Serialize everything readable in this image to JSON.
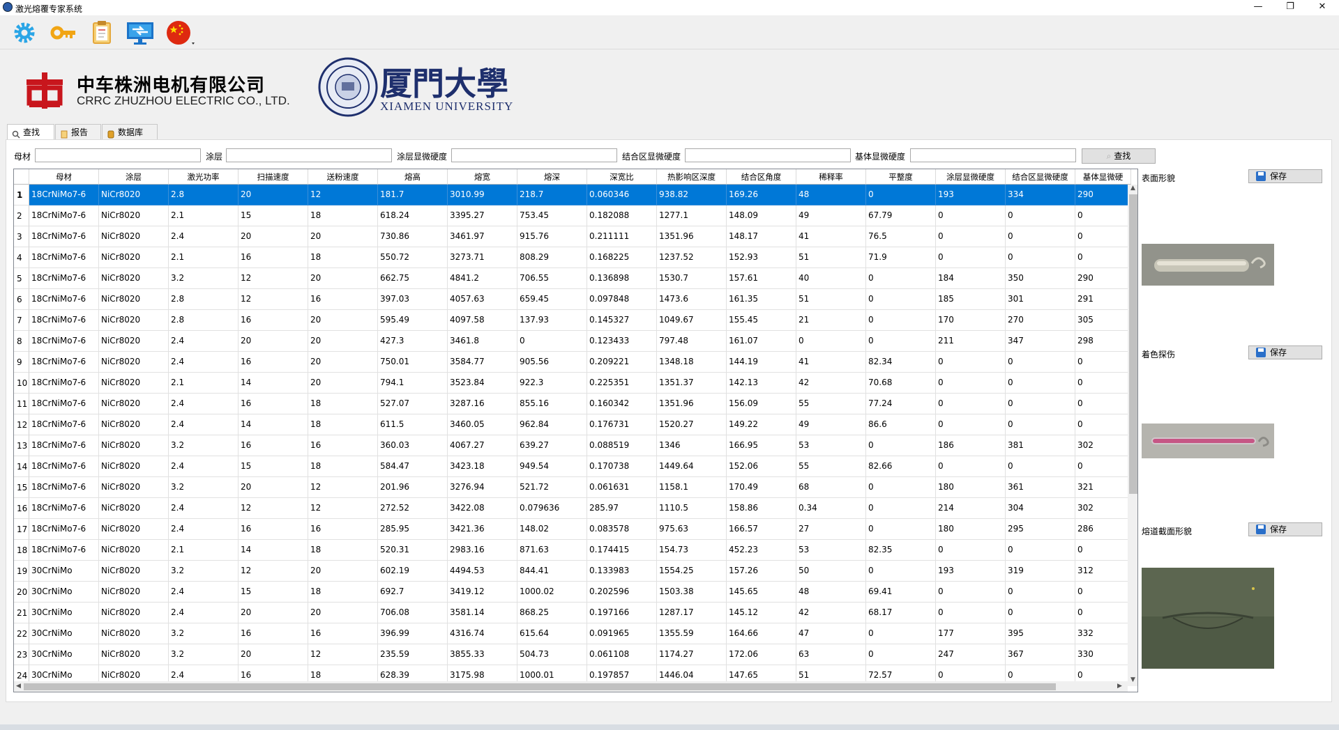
{
  "window": {
    "title": "激光熔覆专家系统",
    "minimize": "—",
    "maximize": "❐",
    "close": "✕"
  },
  "toolbar": {
    "icons": [
      "gear-icon",
      "key-icon",
      "clipboard-icon",
      "network-icon",
      "china-flag-icon"
    ]
  },
  "logos": {
    "crrc_cn": "中车株洲电机有限公司",
    "crrc_en": "CRRC ZHUZHOU ELECTRIC CO., LTD.",
    "xmu_cn": "厦門大學",
    "xmu_en": "XIAMEN UNIVERSITY"
  },
  "tabs": [
    {
      "label": "查找",
      "active": true
    },
    {
      "label": "报告",
      "active": false
    },
    {
      "label": "数据库",
      "active": false
    }
  ],
  "filters": {
    "base_label": "母材",
    "coating_label": "涂层",
    "coating_hv_label": "涂层显微硬度",
    "bond_hv_label": "结合区显微硬度",
    "sub_hv_label": "基体显微硬度",
    "search_label": "查找",
    "base_value": "",
    "coating_value": "",
    "coating_hv_value": "",
    "bond_hv_value": "",
    "sub_hv_value": ""
  },
  "table": {
    "columns": [
      "母材",
      "涂层",
      "激光功率",
      "扫描速度",
      "送粉速度",
      "熔高",
      "熔宽",
      "熔深",
      "深宽比",
      "热影响区深度",
      "结合区角度",
      "稀释率",
      "平整度",
      "涂层显微硬度",
      "结合区显微硬度",
      "基体显微硬"
    ],
    "selected_row": 1,
    "rows": [
      [
        "1",
        "18CrNiMo7-6",
        "NiCr8020",
        "2.8",
        "20",
        "12",
        "181.7",
        "3010.99",
        "218.7",
        "0.060346",
        "938.82",
        "169.26",
        "48",
        "0",
        "193",
        "334",
        "290"
      ],
      [
        "2",
        "18CrNiMo7-6",
        "NiCr8020",
        "2.1",
        "15",
        "18",
        "618.24",
        "3395.27",
        "753.45",
        "0.182088",
        "1277.1",
        "148.09",
        "49",
        "67.79",
        "0",
        "0",
        "0"
      ],
      [
        "3",
        "18CrNiMo7-6",
        "NiCr8020",
        "2.4",
        "20",
        "20",
        "730.86",
        "3461.97",
        "915.76",
        "0.211111",
        "1351.96",
        "148.17",
        "41",
        "76.5",
        "0",
        "0",
        "0"
      ],
      [
        "4",
        "18CrNiMo7-6",
        "NiCr8020",
        "2.1",
        "16",
        "18",
        "550.72",
        "3273.71",
        "808.29",
        "0.168225",
        "1237.52",
        "152.93",
        "51",
        "71.9",
        "0",
        "0",
        "0"
      ],
      [
        "5",
        "18CrNiMo7-6",
        "NiCr8020",
        "3.2",
        "12",
        "20",
        "662.75",
        "4841.2",
        "706.55",
        "0.136898",
        "1530.7",
        "157.61",
        "40",
        "0",
        "184",
        "350",
        "290"
      ],
      [
        "6",
        "18CrNiMo7-6",
        "NiCr8020",
        "2.8",
        "12",
        "16",
        "397.03",
        "4057.63",
        "659.45",
        "0.097848",
        "1473.6",
        "161.35",
        "51",
        "0",
        "185",
        "301",
        "291"
      ],
      [
        "7",
        "18CrNiMo7-6",
        "NiCr8020",
        "2.8",
        "16",
        "20",
        "595.49",
        "4097.58",
        "137.93",
        "0.145327",
        "1049.67",
        "155.45",
        "21",
        "0",
        "170",
        "270",
        "305"
      ],
      [
        "8",
        "18CrNiMo7-6",
        "NiCr8020",
        "2.4",
        "20",
        "20",
        "427.3",
        "3461.8",
        "0",
        "0.123433",
        "797.48",
        "161.07",
        "0",
        "0",
        "211",
        "347",
        "298"
      ],
      [
        "9",
        "18CrNiMo7-6",
        "NiCr8020",
        "2.4",
        "16",
        "20",
        "750.01",
        "3584.77",
        "905.56",
        "0.209221",
        "1348.18",
        "144.19",
        "41",
        "82.34",
        "0",
        "0",
        "0"
      ],
      [
        "10",
        "18CrNiMo7-6",
        "NiCr8020",
        "2.1",
        "14",
        "20",
        "794.1",
        "3523.84",
        "922.3",
        "0.225351",
        "1351.37",
        "142.13",
        "42",
        "70.68",
        "0",
        "0",
        "0"
      ],
      [
        "11",
        "18CrNiMo7-6",
        "NiCr8020",
        "2.4",
        "16",
        "18",
        "527.07",
        "3287.16",
        "855.16",
        "0.160342",
        "1351.96",
        "156.09",
        "55",
        "77.24",
        "0",
        "0",
        "0"
      ],
      [
        "12",
        "18CrNiMo7-6",
        "NiCr8020",
        "2.4",
        "14",
        "18",
        "611.5",
        "3460.05",
        "962.84",
        "0.176731",
        "1520.27",
        "149.22",
        "49",
        "86.6",
        "0",
        "0",
        "0"
      ],
      [
        "13",
        "18CrNiMo7-6",
        "NiCr8020",
        "3.2",
        "16",
        "16",
        "360.03",
        "4067.27",
        "639.27",
        "0.088519",
        "1346",
        "166.95",
        "53",
        "0",
        "186",
        "381",
        "302"
      ],
      [
        "14",
        "18CrNiMo7-6",
        "NiCr8020",
        "2.4",
        "15",
        "18",
        "584.47",
        "3423.18",
        "949.54",
        "0.170738",
        "1449.64",
        "152.06",
        "55",
        "82.66",
        "0",
        "0",
        "0"
      ],
      [
        "15",
        "18CrNiMo7-6",
        "NiCr8020",
        "3.2",
        "20",
        "12",
        "201.96",
        "3276.94",
        "521.72",
        "0.061631",
        "1158.1",
        "170.49",
        "68",
        "0",
        "180",
        "361",
        "321"
      ],
      [
        "16",
        "18CrNiMo7-6",
        "NiCr8020",
        "2.4",
        "12",
        "12",
        "272.52",
        "3422.08",
        "0.079636",
        "285.97",
        "1110.5",
        "158.86",
        "0.34",
        "0",
        "214",
        "304",
        "302"
      ],
      [
        "17",
        "18CrNiMo7-6",
        "NiCr8020",
        "2.4",
        "16",
        "16",
        "285.95",
        "3421.36",
        "148.02",
        "0.083578",
        "975.63",
        "166.57",
        "27",
        "0",
        "180",
        "295",
        "286"
      ],
      [
        "18",
        "18CrNiMo7-6",
        "NiCr8020",
        "2.1",
        "14",
        "18",
        "520.31",
        "2983.16",
        "871.63",
        "0.174415",
        "154.73",
        "452.23",
        "53",
        "82.35",
        "0",
        "0",
        "0"
      ],
      [
        "19",
        "30CrNiMo",
        "NiCr8020",
        "3.2",
        "12",
        "20",
        "602.19",
        "4494.53",
        "844.41",
        "0.133983",
        "1554.25",
        "157.26",
        "50",
        "0",
        "193",
        "319",
        "312"
      ],
      [
        "20",
        "30CrNiMo",
        "NiCr8020",
        "2.4",
        "15",
        "18",
        "692.7",
        "3419.12",
        "1000.02",
        "0.202596",
        "1503.38",
        "145.65",
        "48",
        "69.41",
        "0",
        "0",
        "0"
      ],
      [
        "21",
        "30CrNiMo",
        "NiCr8020",
        "2.4",
        "20",
        "20",
        "706.08",
        "3581.14",
        "868.25",
        "0.197166",
        "1287.17",
        "145.12",
        "42",
        "68.17",
        "0",
        "0",
        "0"
      ],
      [
        "22",
        "30CrNiMo",
        "NiCr8020",
        "3.2",
        "16",
        "16",
        "396.99",
        "4316.74",
        "615.64",
        "0.091965",
        "1355.59",
        "164.66",
        "47",
        "0",
        "177",
        "395",
        "332"
      ],
      [
        "23",
        "30CrNiMo",
        "NiCr8020",
        "3.2",
        "20",
        "12",
        "235.59",
        "3855.33",
        "504.73",
        "0.061108",
        "1174.27",
        "172.06",
        "63",
        "0",
        "247",
        "367",
        "330"
      ],
      [
        "24",
        "30CrNiMo",
        "NiCr8020",
        "2.4",
        "16",
        "18",
        "628.39",
        "3175.98",
        "1000.01",
        "0.197857",
        "1446.04",
        "147.65",
        "51",
        "72.57",
        "0",
        "0",
        "0"
      ]
    ]
  },
  "side": {
    "surface_label": "表面形貌",
    "dye_label": "着色探伤",
    "section_label": "熔道截面形貌",
    "save_label": "保存"
  }
}
